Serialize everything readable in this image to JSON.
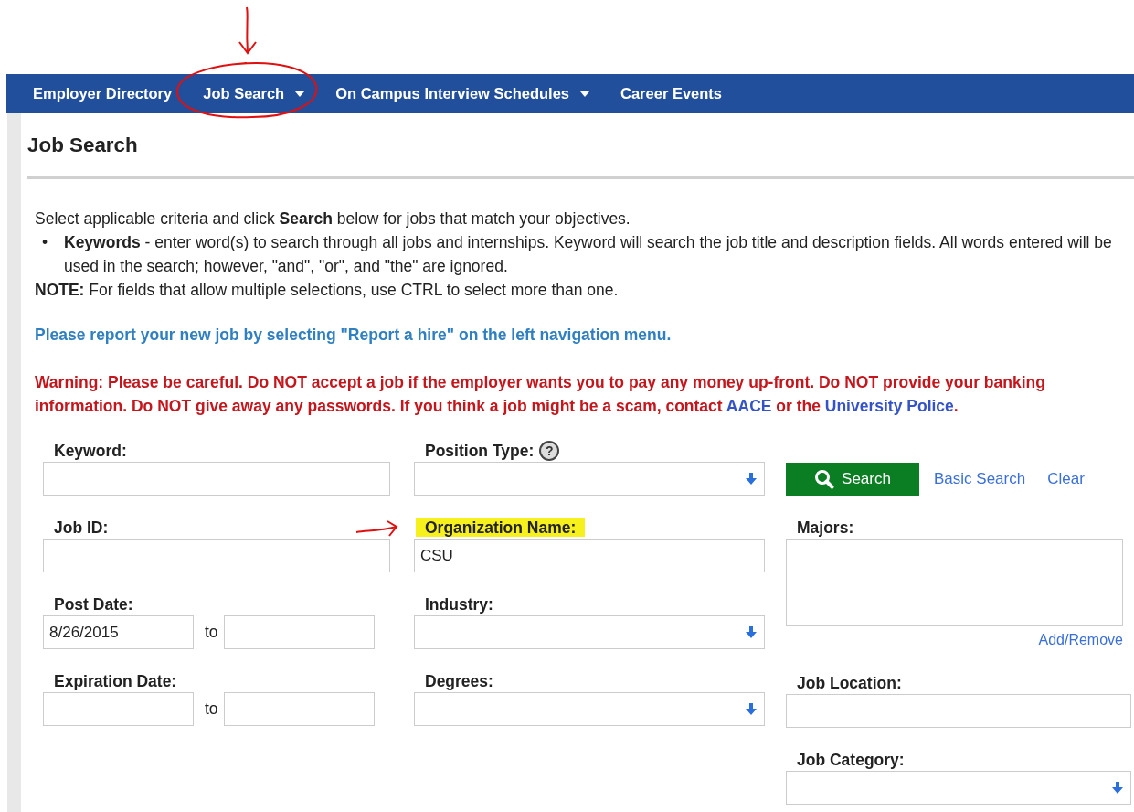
{
  "nav": {
    "items": [
      {
        "label": "Employer Directory",
        "has_menu": false
      },
      {
        "label": "Job Search",
        "has_menu": true
      },
      {
        "label": "On Campus Interview Schedules",
        "has_menu": true
      },
      {
        "label": "Career Events",
        "has_menu": false
      }
    ]
  },
  "page_title": "Job Search",
  "intro": {
    "text": "Select applicable criteria and click **Search** below for jobs that match your objectives.",
    "bullets": [
      {
        "marker": "•",
        "text": "**Keywords** - enter word(s) to search through all jobs and internships. Keyword will search the job title and description fields. All words entered will be\nused in the search; however, \"and\", \"or\", and \"the\" are ignored."
      }
    ],
    "note": "**NOTE:** For fields that allow multiple selections, use CTRL to select more than one."
  },
  "report_notice": "Please report your new job by selecting \"Report a hire\" on the left navigation menu.",
  "warning": [
    {
      "kind": "text",
      "text": "Warning: Please be careful. Do NOT accept a job if the employer wants you to pay any money up-front. Do NOT provide your banking information. Do NOT give away any passwords. If you think a job might be a scam, contact "
    },
    {
      "kind": "link",
      "text": "AACE"
    },
    {
      "kind": "text",
      "text": " or the "
    },
    {
      "kind": "link",
      "text": "University Police"
    },
    {
      "kind": "text",
      "text": "."
    }
  ],
  "form": {
    "columns": [
      [
        {
          "kind": "text",
          "label": "Keyword:",
          "highlighted": false
        },
        {
          "kind": "text",
          "label": "Job ID:",
          "highlighted": false
        },
        {
          "kind": "date_range",
          "label": "Post Date:",
          "from": "8/26/2015",
          "separator": "to"
        },
        {
          "kind": "date_range",
          "label": "Expiration Date:",
          "separator": "to"
        }
      ],
      [
        {
          "kind": "select",
          "label": "Position Type:",
          "help": "?"
        },
        {
          "kind": "text",
          "label": "Organization Name:",
          "value": "CSU",
          "highlighted": true
        },
        {
          "kind": "select",
          "label": "Industry:"
        },
        {
          "kind": "select",
          "label": "Degrees:"
        }
      ],
      [
        {
          "kind": "actions",
          "button": "Search",
          "links": [
            "Basic Search",
            "Clear"
          ]
        },
        {
          "kind": "multi",
          "label": "Majors:",
          "link": "Add/Remove"
        },
        {
          "kind": "text",
          "label": "Job Location:",
          "highlighted": false
        },
        {
          "kind": "select",
          "label": "Job Category:"
        }
      ]
    ]
  }
}
